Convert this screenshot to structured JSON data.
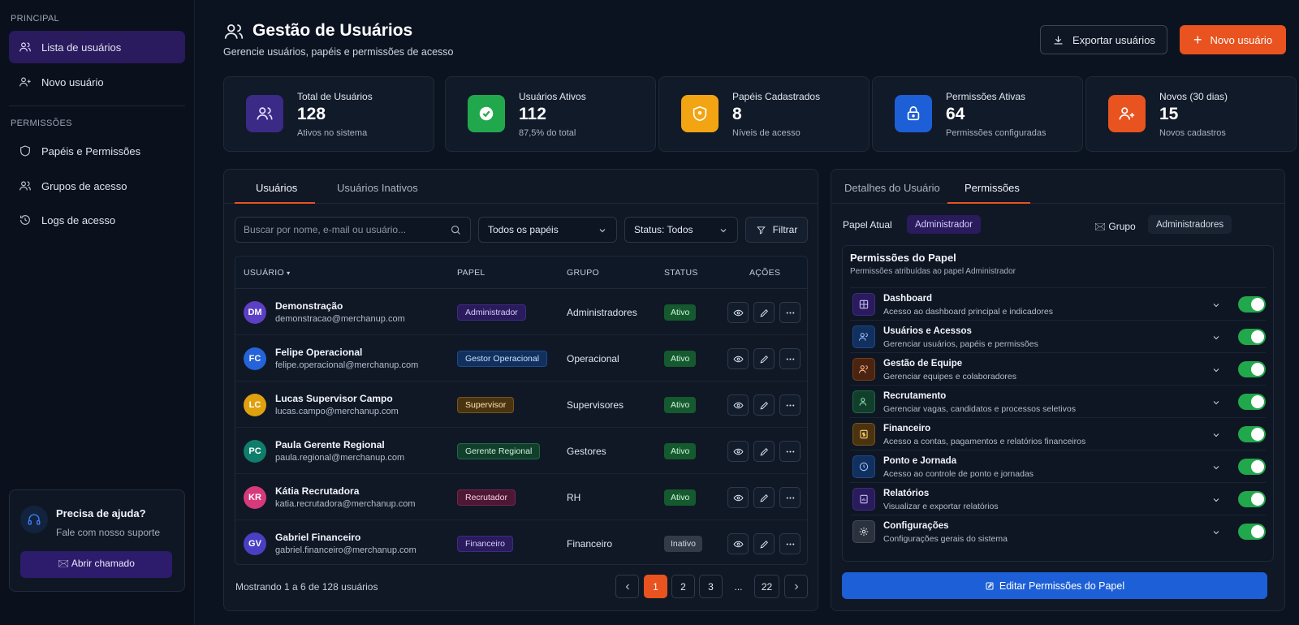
{
  "sidebar": {
    "section1": "PRINCIPAL",
    "section2": "PERMISSÕES",
    "items": [
      {
        "label": "Lista de usuários",
        "icon": "users-icon"
      },
      {
        "label": "Novo usuário",
        "icon": "user-plus-icon"
      },
      {
        "label": "Papéis e Permissões",
        "icon": "shield-icon"
      },
      {
        "label": "Grupos de acesso",
        "icon": "users-group-icon"
      },
      {
        "label": "Logs de acesso",
        "icon": "history-icon"
      }
    ],
    "help": {
      "title": "Precisa de ajuda?",
      "subtitle": "Fale com nosso suporte",
      "button": "🖂 Abrir chamado"
    }
  },
  "header": {
    "title": "Gestão de Usuários",
    "subtitle": "Gerencie usuários, papéis e permissões de acesso",
    "export_label": "Exportar usuários",
    "new_label": "Novo usuário"
  },
  "stats": [
    {
      "label": "Total de Usuários",
      "value": "128",
      "sub": "Ativos no sistema",
      "color": "#3b2a86"
    },
    {
      "label": "Usuários Ativos",
      "value": "112",
      "sub": "87,5% do total",
      "color": "#22a84c"
    },
    {
      "label": "Papéis Cadastrados",
      "value": "8",
      "sub": "Níveis de acesso",
      "color": "#f2a413"
    },
    {
      "label": "Permissões Ativas",
      "value": "64",
      "sub": "Permissões configuradas",
      "color": "#1d5fd6"
    },
    {
      "label": "Novos (30 dias)",
      "value": "15",
      "sub": "Novos cadastros",
      "color": "#e8531f"
    }
  ],
  "users_panel": {
    "tabs": [
      "Usuários",
      "Usuários Inativos"
    ],
    "search_placeholder": "Buscar por nome, e-mail ou usuário...",
    "role_filter": "Todos os papéis",
    "status_filter": "Status: Todos",
    "filter_label": "Filtrar",
    "columns": [
      "USUÁRIO",
      "PAPEL",
      "GRUPO",
      "STATUS",
      "AÇÕES"
    ],
    "rows": [
      {
        "initials": "DM",
        "name": "Demonstração",
        "email": "demonstracao@merchanup.com",
        "role": "Administrador",
        "group": "Administradores",
        "status": "Ativo"
      },
      {
        "initials": "FC",
        "name": "Felipe Operacional",
        "email": "felipe.operacional@merchanup.com",
        "role": "Gestor Operacional",
        "group": "Operacional",
        "status": "Ativo"
      },
      {
        "initials": "LC",
        "name": "Lucas Supervisor Campo",
        "email": "lucas.campo@merchanup.com",
        "role": "Supervisor",
        "group": "Supervisores",
        "status": "Ativo"
      },
      {
        "initials": "PC",
        "name": "Paula Gerente Regional",
        "email": "paula.regional@merchanup.com",
        "role": "Gerente Regional",
        "group": "Gestores",
        "status": "Ativo"
      },
      {
        "initials": "KR",
        "name": "Kátia Recrutadora",
        "email": "katia.recrutadora@merchanup.com",
        "role": "Recrutador",
        "group": "RH",
        "status": "Ativo"
      },
      {
        "initials": "GV",
        "name": "Gabriel Financeiro",
        "email": "gabriel.financeiro@merchanup.com",
        "role": "Financeiro",
        "group": "Financeiro",
        "status": "Inativo"
      }
    ],
    "showing": "Mostrando 1 a 6 de 128 usuários",
    "pages": [
      "1",
      "2",
      "3",
      "...",
      "22"
    ]
  },
  "details_panel": {
    "tabs": [
      "Detalhes do Usuário",
      "Permissões"
    ],
    "role_label": "Papel Atual",
    "role_value": "Administrador",
    "group_label": "🖂 Grupo",
    "group_value": "Administradores",
    "perm_title": "Permissões do Papel",
    "perm_subtitle": "Permissões atribuídas ao papel Administrador",
    "permissions": [
      {
        "name": "Dashboard",
        "desc": "Acesso ao dashboard principal e indicadores",
        "enabled": true
      },
      {
        "name": "Usuários e Acessos",
        "desc": "Gerenciar usuários, papéis e permissões",
        "enabled": true
      },
      {
        "name": "Gestão de Equipe",
        "desc": "Gerenciar equipes e colaboradores",
        "enabled": true
      },
      {
        "name": "Recrutamento",
        "desc": "Gerenciar vagas, candidatos e processos seletivos",
        "enabled": true
      },
      {
        "name": "Financeiro",
        "desc": "Acesso a contas, pagamentos e relatórios financeiros",
        "enabled": true
      },
      {
        "name": "Ponto e Jornada",
        "desc": "Acesso ao controle de ponto e jornadas",
        "enabled": true
      },
      {
        "name": "Relatórios",
        "desc": "Visualizar e exportar relatórios",
        "enabled": true
      },
      {
        "name": "Configurações",
        "desc": "Configurações gerais do sistema",
        "enabled": true
      }
    ],
    "edit_label": "Editar Permissões do Papel"
  }
}
